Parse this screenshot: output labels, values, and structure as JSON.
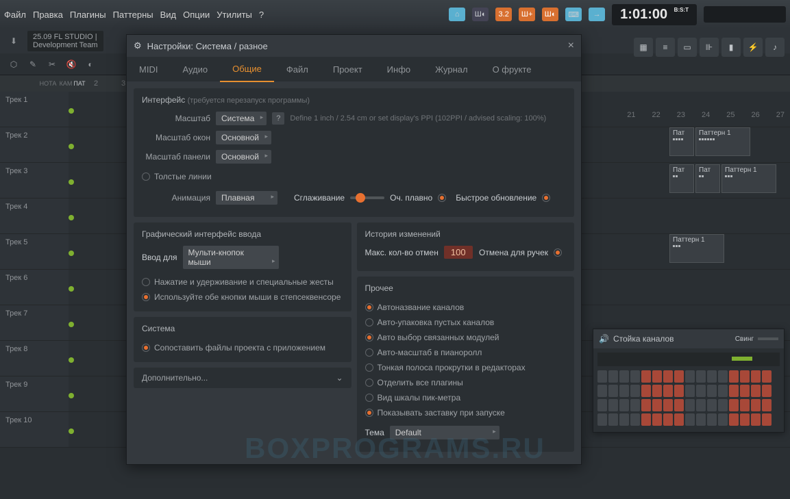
{
  "menubar": {
    "items": [
      "Файл",
      "Правка",
      "Плагины",
      "Паттерны",
      "Вид",
      "Опции",
      "Утилиты",
      "?"
    ],
    "time": "1:01:00",
    "time_label": "B:S:T"
  },
  "infobar": {
    "version": "25.09",
    "title": "FL STUDIO |",
    "team": "Development Team"
  },
  "ruler_labels": [
    "НОТА",
    "КАМ",
    "ПАТ"
  ],
  "ruler_nums": [
    "2",
    "3"
  ],
  "timeline": [
    "21",
    "22",
    "23",
    "24",
    "25",
    "26",
    "27"
  ],
  "tracks": [
    {
      "label": "Трек 1"
    },
    {
      "label": "Трек 2"
    },
    {
      "label": "Трек 3"
    },
    {
      "label": "Трек 4"
    },
    {
      "label": "Трек 5"
    },
    {
      "label": "Трек 6"
    },
    {
      "label": "Трек 7"
    },
    {
      "label": "Трек 8"
    },
    {
      "label": "Трек 9"
    },
    {
      "label": "Трек 10"
    }
  ],
  "patterns": {
    "p1": "Паттерн 1",
    "shortp": "Пат"
  },
  "dialog": {
    "title": "Настройки: Система / разное",
    "tabs": [
      "MIDI",
      "Аудио",
      "Общие",
      "Файл",
      "Проект",
      "Инфо",
      "Журнал",
      "О фрукте"
    ],
    "interface": {
      "title": "Интерфейс",
      "note": "(требуется перезапуск программы)",
      "scale_label": "Масштаб",
      "scale_value": "Система",
      "scale_hint": "Define 1 inch / 2.54 cm or set display's PPI (102PPI / advised scaling: 100%)",
      "window_scale_label": "Масштаб окон",
      "window_scale_value": "Основной",
      "panel_scale_label": "Масштаб панели",
      "panel_scale_value": "Основной",
      "thick_lines": "Толстые линии",
      "animation_label": "Анимация",
      "animation_value": "Плавная",
      "smoothing_label": "Сглаживание",
      "ultra_smooth": "Оч. плавно",
      "fast_update": "Быстрое обновление"
    },
    "input": {
      "title": "Графический интерфейс ввода",
      "input_for": "Ввод для",
      "input_value": "Мульти-кнопок мыши",
      "hold_gestures": "Нажатие и удерживание и специальные жесты",
      "both_buttons": "Используйте обе кнопки мыши в степсеквенсоре"
    },
    "system": {
      "title": "Система",
      "associate": "Сопоставить файлы проекта с приложением"
    },
    "extra": "Дополнительно...",
    "history": {
      "title": "История изменений",
      "max_undo": "Макс. кол-во отмен",
      "max_value": "100",
      "knob_undo": "Отмена для ручек"
    },
    "other": {
      "title": "Прочее",
      "auto_name": "Автоназвание каналов",
      "auto_pack": "Авто-упаковка пустых каналов",
      "auto_select": "Авто выбор связанных модулей",
      "auto_zoom": "Авто-масштаб в пианоролл",
      "thin_scroll": "Тонкая полоса прокрутки в редакторах",
      "detach": "Отделить все плагины",
      "peak_scale": "Вид шкалы пик-метра",
      "splash": "Показывать заставку при запуске",
      "theme_label": "Тема",
      "theme_value": "Default"
    }
  },
  "rack": {
    "title": "Стойка каналов",
    "swing": "Свинг"
  },
  "watermark": "BOXPROGRAMS.RU"
}
